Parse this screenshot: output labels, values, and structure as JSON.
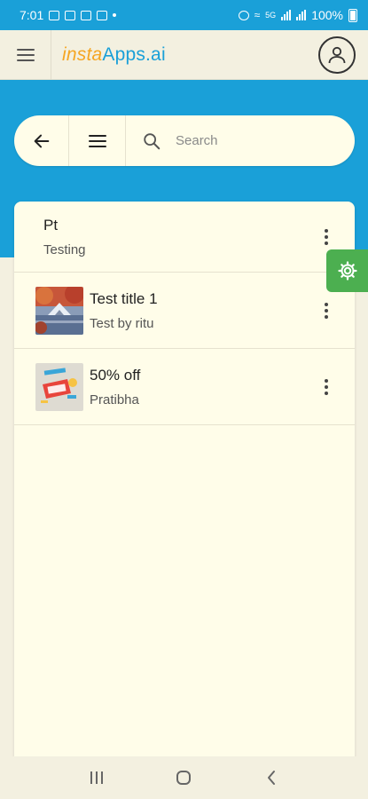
{
  "status_bar": {
    "time": "7:01",
    "battery_text": "100%",
    "network": "5G"
  },
  "app": {
    "logo_insta": "insta",
    "logo_apps": "Apps.ai"
  },
  "search": {
    "placeholder": "Search"
  },
  "list": {
    "items": [
      {
        "title": "Pt",
        "subtitle": "Testing"
      },
      {
        "title": "Test title 1",
        "subtitle": "Test by ritu"
      },
      {
        "title": "50% off",
        "subtitle": "Pratibha"
      }
    ]
  },
  "colors": {
    "brand_blue": "#1aa0d8",
    "brand_orange": "#f5a623",
    "settings_green": "#4caf50",
    "background": "#f3f0e0",
    "card": "#fffde9"
  },
  "icons": {
    "menu": "hamburger-icon",
    "profile": "user-icon",
    "back": "arrow-left-icon",
    "list": "list-icon",
    "search": "search-icon",
    "more": "kebab-icon",
    "settings": "gear-icon"
  }
}
